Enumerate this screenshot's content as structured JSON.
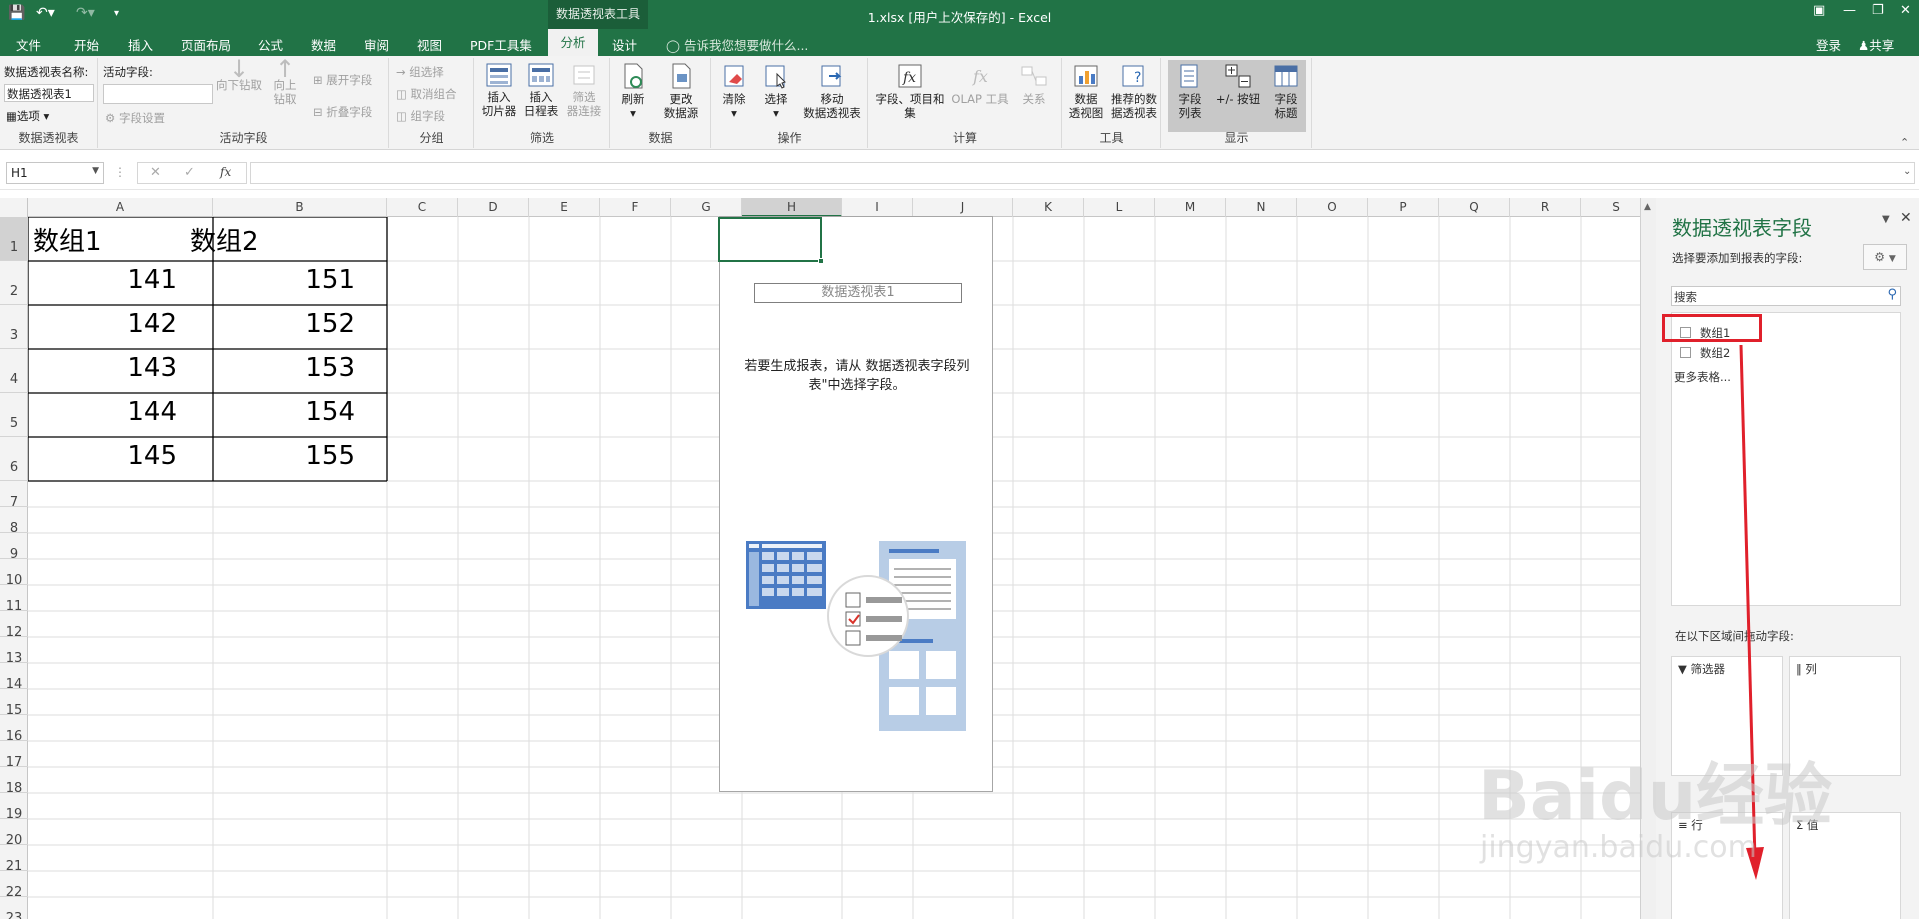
{
  "window": {
    "title": "1.xlsx [用户上次保存的] - Excel",
    "context_tool": "数据透视表工具"
  },
  "tabs": [
    "文件",
    "开始",
    "插入",
    "页面布局",
    "公式",
    "数据",
    "审阅",
    "视图",
    "PDF工具集",
    "分析",
    "设计"
  ],
  "tell_me": "告诉我您想要做什么...",
  "account": {
    "login": "登录",
    "share": "共享"
  },
  "ribbon": {
    "pivot_name_label": "数据透视表名称:",
    "pivot_name_value": "数据透视表1",
    "options_label": "选项",
    "group_pivot": "数据透视表",
    "active_field_label": "活动字段:",
    "field_settings": "字段设置",
    "drill_down": "向下钻取",
    "drill_up": "向上钻取",
    "expand_field": "展开字段",
    "collapse_field": "折叠字段",
    "group_active_field": "活动字段",
    "group_selection": "组选择",
    "ungroup": "取消组合",
    "group_field": "组字段",
    "group_group": "分组",
    "insert_slicer": "插入\n切片器",
    "insert_timeline": "插入\n日程表",
    "filter_connections": "筛选\n器连接",
    "group_filter": "筛选",
    "refresh": "刷新",
    "change_source": "更改\n数据源",
    "group_data": "数据",
    "clear": "清除",
    "select": "选择",
    "move_pivot": "移动\n数据透视表",
    "group_actions": "操作",
    "fields_items_sets": "字段、项目和\n集",
    "olap_tools": "OLAP 工具",
    "relationships": "关系",
    "group_calc": "计算",
    "pivot_chart": "数据\n透视图",
    "recommended_pivot": "推荐的数\n据透视表",
    "group_tools": "工具",
    "field_list": "字段\n列表",
    "plus_minus_buttons": "+/- 按钮",
    "field_headers": "字段\n标题",
    "group_show": "显示"
  },
  "formula_bar": {
    "name_box": "H1",
    "fx": "fx",
    "formula": ""
  },
  "columns": [
    "A",
    "B",
    "C",
    "D",
    "E",
    "F",
    "G",
    "H",
    "I",
    "J",
    "K",
    "L",
    "M",
    "N",
    "O",
    "P",
    "Q",
    "R",
    "S"
  ],
  "rows": [
    "1",
    "2",
    "3",
    "4",
    "5",
    "6",
    "7",
    "8",
    "9",
    "10",
    "11",
    "12",
    "13",
    "14",
    "15",
    "16",
    "17",
    "18",
    "19",
    "20",
    "21",
    "22",
    "23"
  ],
  "table": {
    "headers": [
      "数组1",
      "数组2"
    ],
    "rows": [
      [
        "141",
        "151"
      ],
      [
        "142",
        "152"
      ],
      [
        "143",
        "153"
      ],
      [
        "144",
        "154"
      ],
      [
        "145",
        "155"
      ]
    ]
  },
  "pivot_placeholder": {
    "name": "数据透视表1",
    "instruction_line1": "若要生成报表，请从 数据透视表字段列",
    "instruction_line2": "表\"中选择字段。"
  },
  "field_pane": {
    "title": "数据透视表字段",
    "subtitle": "选择要添加到报表的字段:",
    "search_placeholder": "搜索",
    "fields": [
      "数组1",
      "数组2"
    ],
    "more_tables": "更多表格...",
    "drag_hint": "在以下区域间拖动字段:",
    "area_filters": "筛选器",
    "area_columns": "列",
    "area_rows": "行",
    "area_values": "值"
  },
  "watermark": {
    "brand": "Baidu经验",
    "url": "jingyan.baidu.com"
  },
  "colors": {
    "excel_green": "#217346",
    "highlight_red": "#e0202b"
  }
}
